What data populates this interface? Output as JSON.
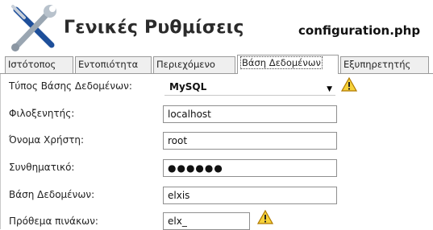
{
  "header": {
    "title": "Γενικές Ρυθμίσεις",
    "filename": "configuration.php",
    "logo_icon": "tools-icon"
  },
  "tabs": [
    {
      "label": "Ιστότοπος",
      "active": false
    },
    {
      "label": "Εντοπιότητα",
      "active": false
    },
    {
      "label": "Περιεχόμενο",
      "active": false
    },
    {
      "label": "Βάση Δεδομένων",
      "active": true
    },
    {
      "label": "Εξυπηρετητής",
      "active": false
    }
  ],
  "form": {
    "db_type": {
      "label": "Τύπος Βάσης Δεδομένων:",
      "value": "MySQL"
    },
    "host": {
      "label": "Φιλοξενητής:",
      "value": "localhost"
    },
    "user": {
      "label": "Όνομα Χρήστη:",
      "value": "root"
    },
    "password": {
      "label": "Συνθηματικό:",
      "value": "●●●●●●"
    },
    "database": {
      "label": "Βάση Δεδομένων:",
      "value": "elxis"
    },
    "prefix": {
      "label": "Πρόθεμα πινάκων:",
      "value": "elx_"
    }
  },
  "icons": {
    "warning": "warning-icon",
    "dropdown": "chevron-down-icon"
  },
  "colors": {
    "warning_fill": "#f6d23a",
    "warning_stroke": "#b07a00"
  }
}
